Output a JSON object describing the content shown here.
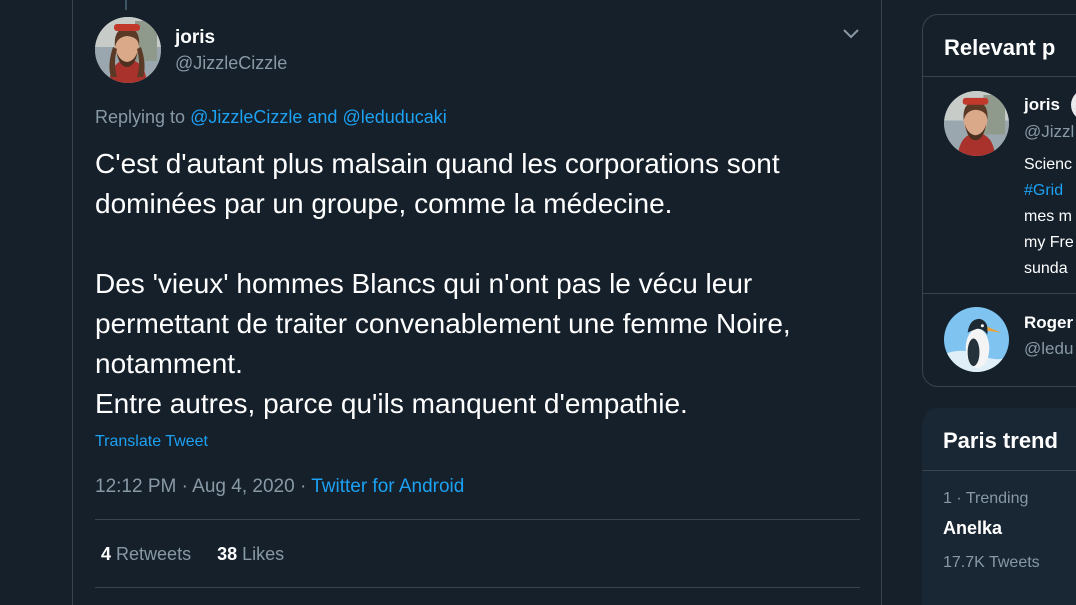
{
  "tweet": {
    "author_name": "joris",
    "author_handle": "@JizzleCizzle",
    "replying_prefix": "Replying to",
    "replying_to_1": "@JizzleCizzle",
    "replying_and": "and",
    "replying_to_2": "@leduducaki",
    "text": "C'est d'autant plus malsain quand les corporations sont dominées par un groupe, comme la médecine.\n\nDes 'vieux' hommes Blancs qui n'ont pas le vécu leur permettant de traiter convenablement une femme Noire, notamment.\nEntre autres, parce qu'ils manquent d'empathie.",
    "translate_label": "Translate Tweet",
    "time": "12:12 PM",
    "date": "Aug 4, 2020",
    "separator": "·",
    "source": "Twitter for Android",
    "retweets_count": "4",
    "retweets_label": "Retweets",
    "likes_count": "38",
    "likes_label": "Likes"
  },
  "sidebar": {
    "relevant_title": "Relevant p",
    "people": [
      {
        "name": "joris",
        "handle": "@Jizzl",
        "bio_line1": "Scienc",
        "bio_hashtag": "#Grid",
        "bio_line3": "mes m",
        "bio_line4": "my Fre",
        "bio_line5": "sunda"
      },
      {
        "name": "Roger",
        "handle": "@ledu"
      }
    ],
    "trends_title": "Paris trend",
    "trend": {
      "rank": "1",
      "separator": "·",
      "label": "Trending",
      "name": "Anelka",
      "count": "17.7K Tweets"
    }
  },
  "colors": {
    "background": "#15202b",
    "border": "#38444d",
    "accent": "#1da1f2",
    "secondary_text": "#8899a6"
  },
  "icons": [
    "chevron-down-icon"
  ]
}
